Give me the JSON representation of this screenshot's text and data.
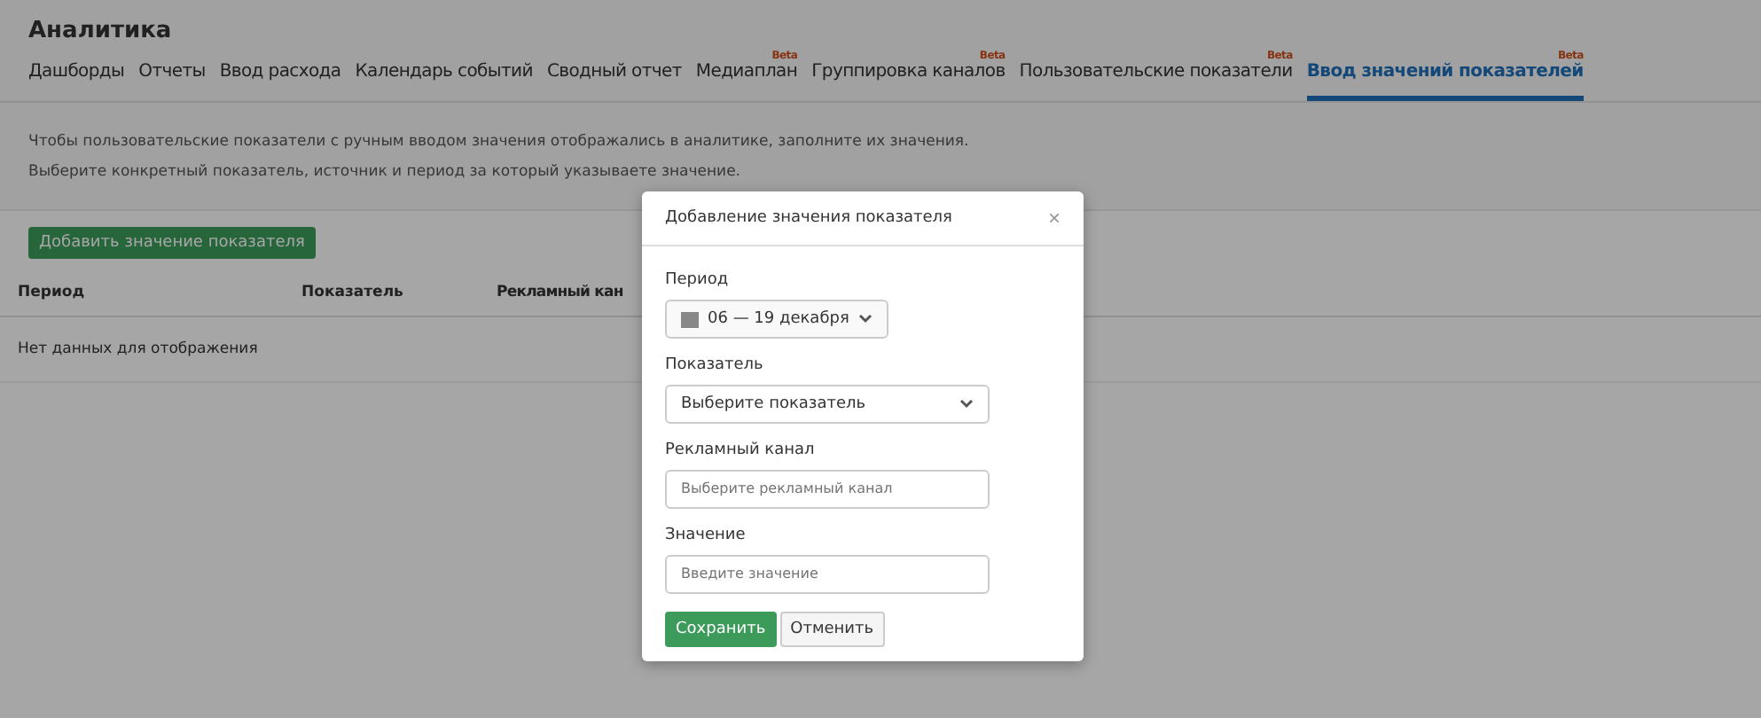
{
  "page": {
    "title": "Аналитика"
  },
  "tabs": [
    {
      "label": "Дашборды",
      "selected": false
    },
    {
      "label": "Отчеты",
      "selected": false
    },
    {
      "label": "Ввод расхода",
      "selected": false
    },
    {
      "label": "Календарь событий",
      "selected": false
    },
    {
      "label": "Сводный отчет",
      "selected": false
    },
    {
      "label": "Медиаплан",
      "badge": "Beta",
      "selected": false
    },
    {
      "label": "Группировка каналов",
      "badge": "Beta",
      "selected": false
    },
    {
      "label": "Пользовательские показатели",
      "badge": "Beta",
      "selected": false
    },
    {
      "label": "Ввод значений показателей",
      "badge": "Beta",
      "selected": true
    }
  ],
  "info": [
    "Чтобы пользовательские показатели с ручным вводом значения отображались в аналитике, заполните их значения.",
    "Выберите конкретный показатель, источник и период за который указываете значение."
  ],
  "add_button": "Добавить значение показателя",
  "table": {
    "columns": [
      "Период",
      "Показатель",
      "Рекламный кан"
    ],
    "empty": "Нет данных для отображения"
  },
  "modal": {
    "title": "Добавление значения показателя",
    "close": "×",
    "fields": [
      {
        "kind": "date",
        "label": "Период",
        "value": "06 — 19 декабря"
      },
      {
        "kind": "select",
        "label": "Показатель",
        "value": "Выберите показатель"
      },
      {
        "kind": "input",
        "label": "Рекламный канал",
        "placeholder": "Выберите рекламный канал"
      },
      {
        "kind": "input",
        "label": "Значение",
        "placeholder": "Введите значение"
      }
    ],
    "buttons": [
      {
        "label": "Сохранить",
        "primary": true
      },
      {
        "label": "Отменить",
        "primary": false
      }
    ]
  }
}
